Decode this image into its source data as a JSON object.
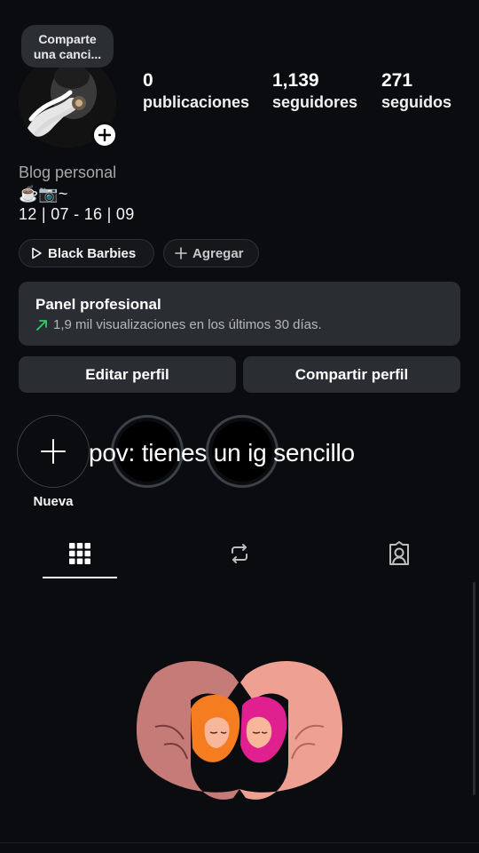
{
  "profile": {
    "song_bubble": "Comparte una canci...",
    "stats": [
      {
        "value": "0",
        "label": "publicaciones"
      },
      {
        "value": "1,139",
        "label": "seguidores"
      },
      {
        "value": "271",
        "label": "seguidos"
      }
    ],
    "category": "Blog personal",
    "emoji_line": "☕📷~",
    "bio_line": "12 | 07 - 16 | 09"
  },
  "chips": [
    {
      "label": "Black Barbies",
      "icon": "play-outline-icon"
    },
    {
      "label": "Agregar",
      "icon": "plus-icon"
    }
  ],
  "panel": {
    "title": "Panel profesional",
    "subtitle": "1,9 mil visualizaciones en los últimos 30 días.",
    "accent": "#2ecc71"
  },
  "buttons": {
    "edit": "Editar perfil",
    "share": "Compartir perfil"
  },
  "highlights": {
    "new_label": "Nueva",
    "overlay_text": "pov: tienes un ig sencillo"
  },
  "tabs": [
    {
      "name": "grid",
      "icon": "grid-icon",
      "active": true
    },
    {
      "name": "reposts",
      "icon": "repost-icon",
      "active": false
    },
    {
      "name": "tagged",
      "icon": "tagged-person-icon",
      "active": false
    }
  ]
}
